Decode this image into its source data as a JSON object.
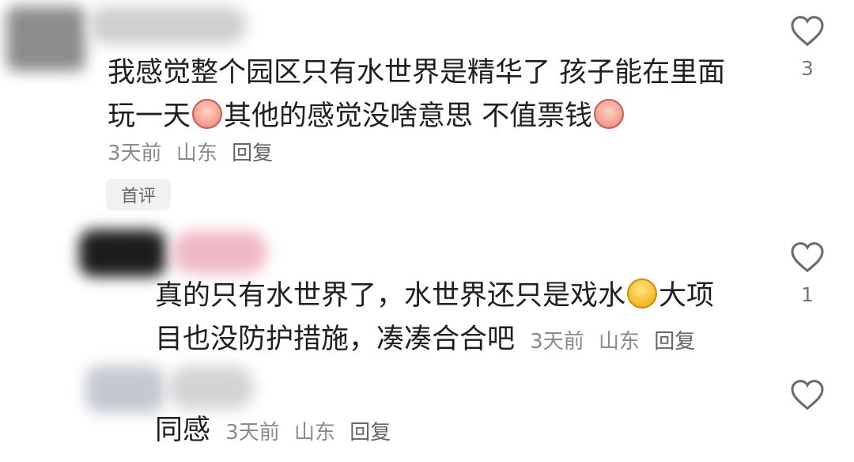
{
  "comments": [
    {
      "lines": [
        "我感觉整个园区只有水世界是精华了 孩子能在里面",
        "玩一天",
        "其他的感觉没啥意思 不值票钱"
      ],
      "emoji": "crying-face-emoji",
      "time": "3天前",
      "location": "山东",
      "reply_label": "回复",
      "badge": "首评",
      "likes": "3"
    },
    {
      "lines": [
        "真的只有水世界了，水世界还只是戏水",
        "大项",
        "目也没防护措施，凑凑合合吧"
      ],
      "emoji": "tears-of-joy-emoji",
      "time": "3天前",
      "location": "山东",
      "reply_label": "回复",
      "likes": "1"
    },
    {
      "lines": [
        "同感"
      ],
      "time": "3天前",
      "location": "山东",
      "reply_label": "回复"
    }
  ],
  "icons": {
    "like": "heart-icon"
  }
}
